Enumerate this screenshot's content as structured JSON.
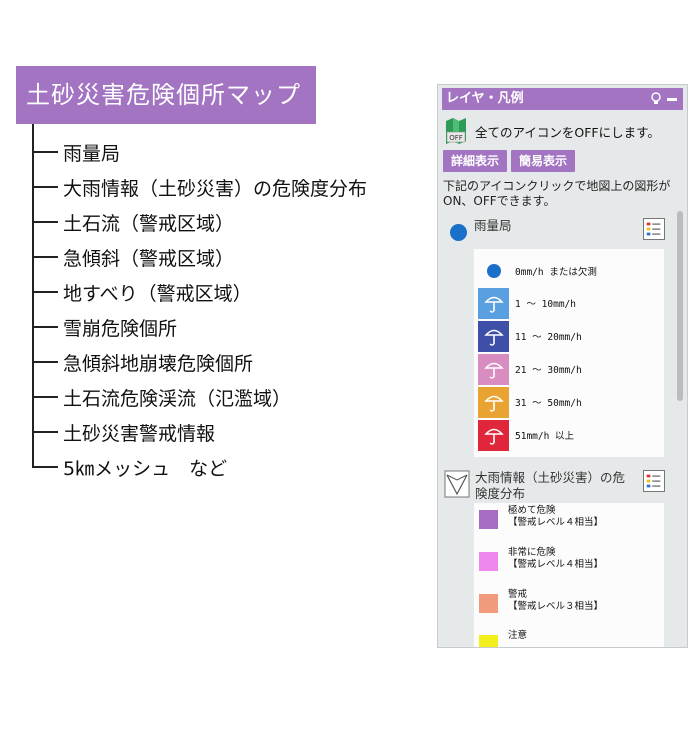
{
  "tree": {
    "title": "土砂災害危険個所マップ",
    "items": [
      "雨量局",
      "大雨情報（土砂災害）の危険度分布",
      "土石流（警戒区域）",
      "急傾斜（警戒区域）",
      "地すべり（警戒区域）",
      "雪崩危険個所",
      "急傾斜地崩壊危険個所",
      "土石流危険渓流（氾濫域）",
      "土砂災害警戒情報",
      "5㎞メッシュ　など"
    ]
  },
  "panel": {
    "header": "レイヤ・凡例",
    "off_icon_label": "OFF",
    "all_off_text": "全てのアイコンをOFFにします。",
    "detail_button": "詳細表示",
    "simple_button": "簡易表示",
    "description": "下記のアイコンクリックで地図上の図形がON、OFFできます。",
    "rain_layer": {
      "title": "雨量局",
      "entries": [
        {
          "label": "0mm/h または欠測",
          "color": "#1a6fc9"
        },
        {
          "label": "1 ～ 10mm/h",
          "color": "#5aa0e0"
        },
        {
          "label": "11 ～ 20mm/h",
          "color": "#3e4fa8"
        },
        {
          "label": "21 ～ 30mm/h",
          "color": "#d98cc0"
        },
        {
          "label": "31 ～ 50mm/h",
          "color": "#e8a332"
        },
        {
          "label": "51mm/h 以上",
          "color": "#e0263a"
        }
      ]
    },
    "danger_layer": {
      "title_line1": "大雨情報（土砂災害）の危",
      "title_line2": "険度分布",
      "entries": [
        {
          "line1": "極めて危険",
          "line2": "【警戒レベル４相当】",
          "color": "#a66cc4"
        },
        {
          "line1": "非常に危険",
          "line2": "【警戒レベル４相当】",
          "color": "#ee88ee"
        },
        {
          "line1": "警戒",
          "line2": "【警戒レベル３相当】",
          "color": "#f29a7c"
        },
        {
          "line1": "注意",
          "line2": "",
          "color": "#f2ef1c"
        }
      ]
    }
  }
}
